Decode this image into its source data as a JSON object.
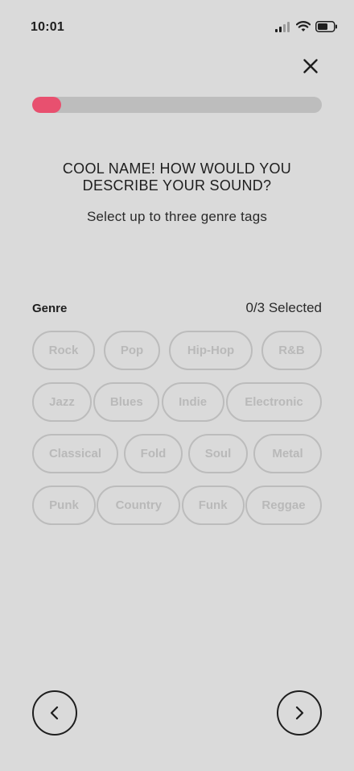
{
  "status_bar": {
    "time": "10:01",
    "icons": [
      "cellular-signal-icon",
      "wifi-icon",
      "battery-icon"
    ]
  },
  "header": {
    "close_icon": "close-icon"
  },
  "progress": {
    "value": 0.1,
    "color": "#e8506f",
    "track_color": "#bdbdbd"
  },
  "main": {
    "title": "COOL NAME! HOW WOULD YOU DESCRIBE YOUR SOUND?",
    "subtitle": "Select up to three genre tags"
  },
  "genre": {
    "label": "Genre",
    "count_text": "0/3 Selected",
    "tags": [
      [
        "Rock",
        "Pop",
        "Hip-Hop",
        "R&B"
      ],
      [
        "Jazz",
        "Blues",
        "Indie",
        "Electronic"
      ],
      [
        "Classical",
        "Fold",
        "Soul",
        "Metal"
      ],
      [
        "Punk",
        "Country",
        "Funk",
        "Reggae"
      ]
    ]
  },
  "navigation": {
    "prev_icon": "chevron-left-icon",
    "next_icon": "chevron-right-icon"
  }
}
